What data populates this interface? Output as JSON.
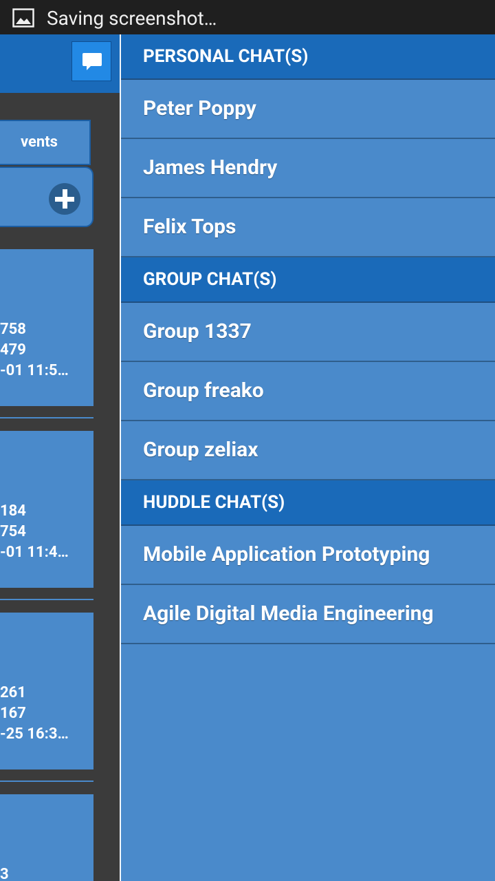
{
  "status_bar": {
    "text": "Saving screenshot…",
    "icon": "image-icon"
  },
  "left_app": {
    "events_tab_label": "vents",
    "cards": [
      {
        "line1": "758",
        "line2": "479",
        "line3": "-01 11:5…"
      },
      {
        "line1": "184",
        "line2": "754",
        "line3": "-01 11:4…"
      },
      {
        "line1": "261",
        "line2": "167",
        "line3": "-25 16:3…"
      },
      {
        "line1": "3",
        "line2": "",
        "line3": ""
      }
    ]
  },
  "drawer": {
    "personal_header": "PERSONAL CHAT(S)",
    "personal": [
      "Peter Poppy",
      "James Hendry",
      "Felix Tops"
    ],
    "group_header": "GROUP CHAT(S)",
    "groups": [
      "Group 1337",
      "Group freako",
      "Group zeliax"
    ],
    "huddle_header": "HUDDLE CHAT(S)",
    "huddles": [
      "Mobile Application Prototyping",
      "Agile Digital Media Engineering"
    ]
  },
  "colors": {
    "accent": "#1a6ab9",
    "panel": "#4a8acb",
    "status_bar": "#1f1f1f"
  }
}
